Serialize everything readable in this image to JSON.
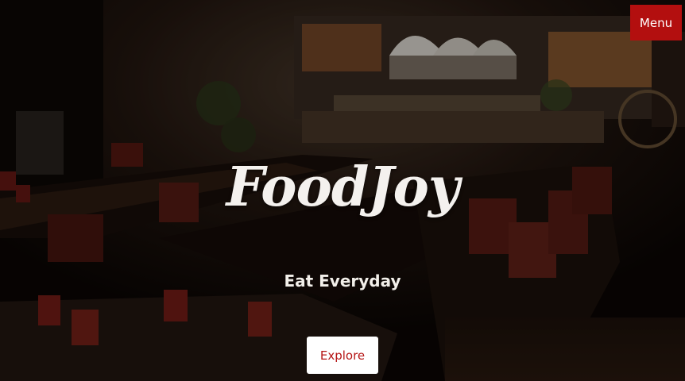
{
  "header": {
    "menu_label": "Menu"
  },
  "hero": {
    "title": "FoodJoy",
    "tagline": "Eat Everyday",
    "explore_label": "Explore"
  },
  "colors": {
    "accent": "#b30f0f",
    "explore_text": "#b51414",
    "text_light": "#f4f1ee"
  }
}
